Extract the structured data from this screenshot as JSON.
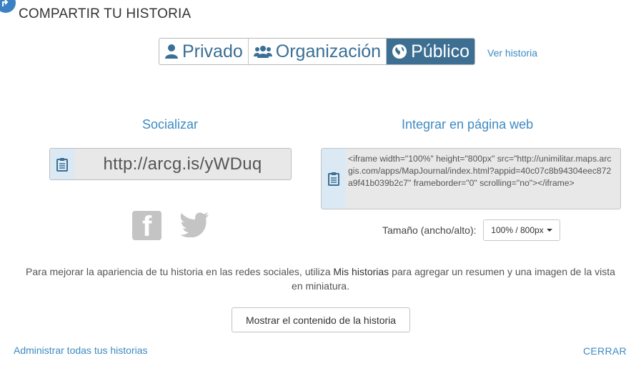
{
  "header": {
    "title": "COMPARTIR TU HISTORIA",
    "icon": "share-icon"
  },
  "visibility": {
    "options": [
      {
        "label": "Privado",
        "icon": "user-icon",
        "active": false
      },
      {
        "label": "Organización",
        "icon": "group-icon",
        "active": false
      },
      {
        "label": "Público",
        "icon": "globe-icon",
        "active": true
      }
    ],
    "view_link": "Ver historia"
  },
  "social": {
    "heading": "Socializar",
    "short_url": "http://arcg.is/yWDuq",
    "networks": [
      {
        "name": "facebook",
        "icon": "facebook-icon"
      },
      {
        "name": "twitter",
        "icon": "twitter-icon"
      }
    ]
  },
  "embed": {
    "heading": "Integrar en página web",
    "code": "<iframe width=\"100%\" height=\"800px\" src=\"http://unimilitar.maps.arcgis.com/apps/MapJournal/index.html?appid=40c07c8b94304eec872a9f41b039b2c7\" frameborder=\"0\" scrolling=\"no\"></iframe>",
    "size_label": "Tamaño (ancho/alto):",
    "size_value": "100% / 800px"
  },
  "info": {
    "text_before": "Para mejorar la apariencia de tu historia en las redes sociales, utiliza ",
    "link": "Mis historias",
    "text_after": " para agregar un resumen y una imagen de la vista en miniatura."
  },
  "footer": {
    "show_button": "Mostrar el contenido de la historia",
    "admin_link": "Administrar todas tus historias",
    "close_link": "CERRAR"
  },
  "colors": {
    "accent": "#3e8ac1",
    "active": "#3d6f93",
    "muted_icon": "#c4c4c4"
  }
}
